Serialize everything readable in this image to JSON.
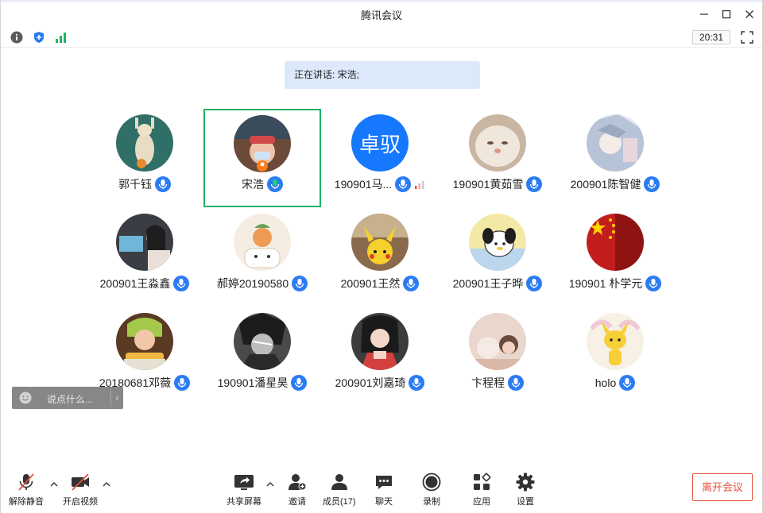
{
  "window": {
    "title": "腾讯会议"
  },
  "infobar": {
    "timer": "20:31"
  },
  "speaker": {
    "text": "正在讲话: 宋浩;"
  },
  "participants": [
    {
      "name": "郭千钰"
    },
    {
      "name": "宋浩",
      "active": true
    },
    {
      "name": "190901马...",
      "avatar_text": "卓驭"
    },
    {
      "name": "190901黄茹雪"
    },
    {
      "name": "200901陈智健"
    },
    {
      "name": "200901王淼鑫"
    },
    {
      "name": "郝婷20190580"
    },
    {
      "name": "200901王然"
    },
    {
      "name": "200901王子晔"
    },
    {
      "name": "190901 朴学元"
    },
    {
      "name": "20180681邓薇"
    },
    {
      "name": "190901潘星昊"
    },
    {
      "name": "200901刘嘉琦"
    },
    {
      "name": "卞程程"
    },
    {
      "name": "holo"
    }
  ],
  "chat": {
    "placeholder": "说点什么..."
  },
  "toolbar": {
    "unmute": "解除静音",
    "start_video": "开启视频",
    "share_screen": "共享屏幕",
    "invite": "邀请",
    "members": "成员(17)",
    "chat": "聊天",
    "record": "录制",
    "apps": "应用",
    "settings": "设置",
    "leave": "离开会议"
  },
  "colors": {
    "accent": "#2b7cf3",
    "active_border": "#22b264",
    "leave": "#e5503c",
    "banner": "#dce9fb"
  }
}
